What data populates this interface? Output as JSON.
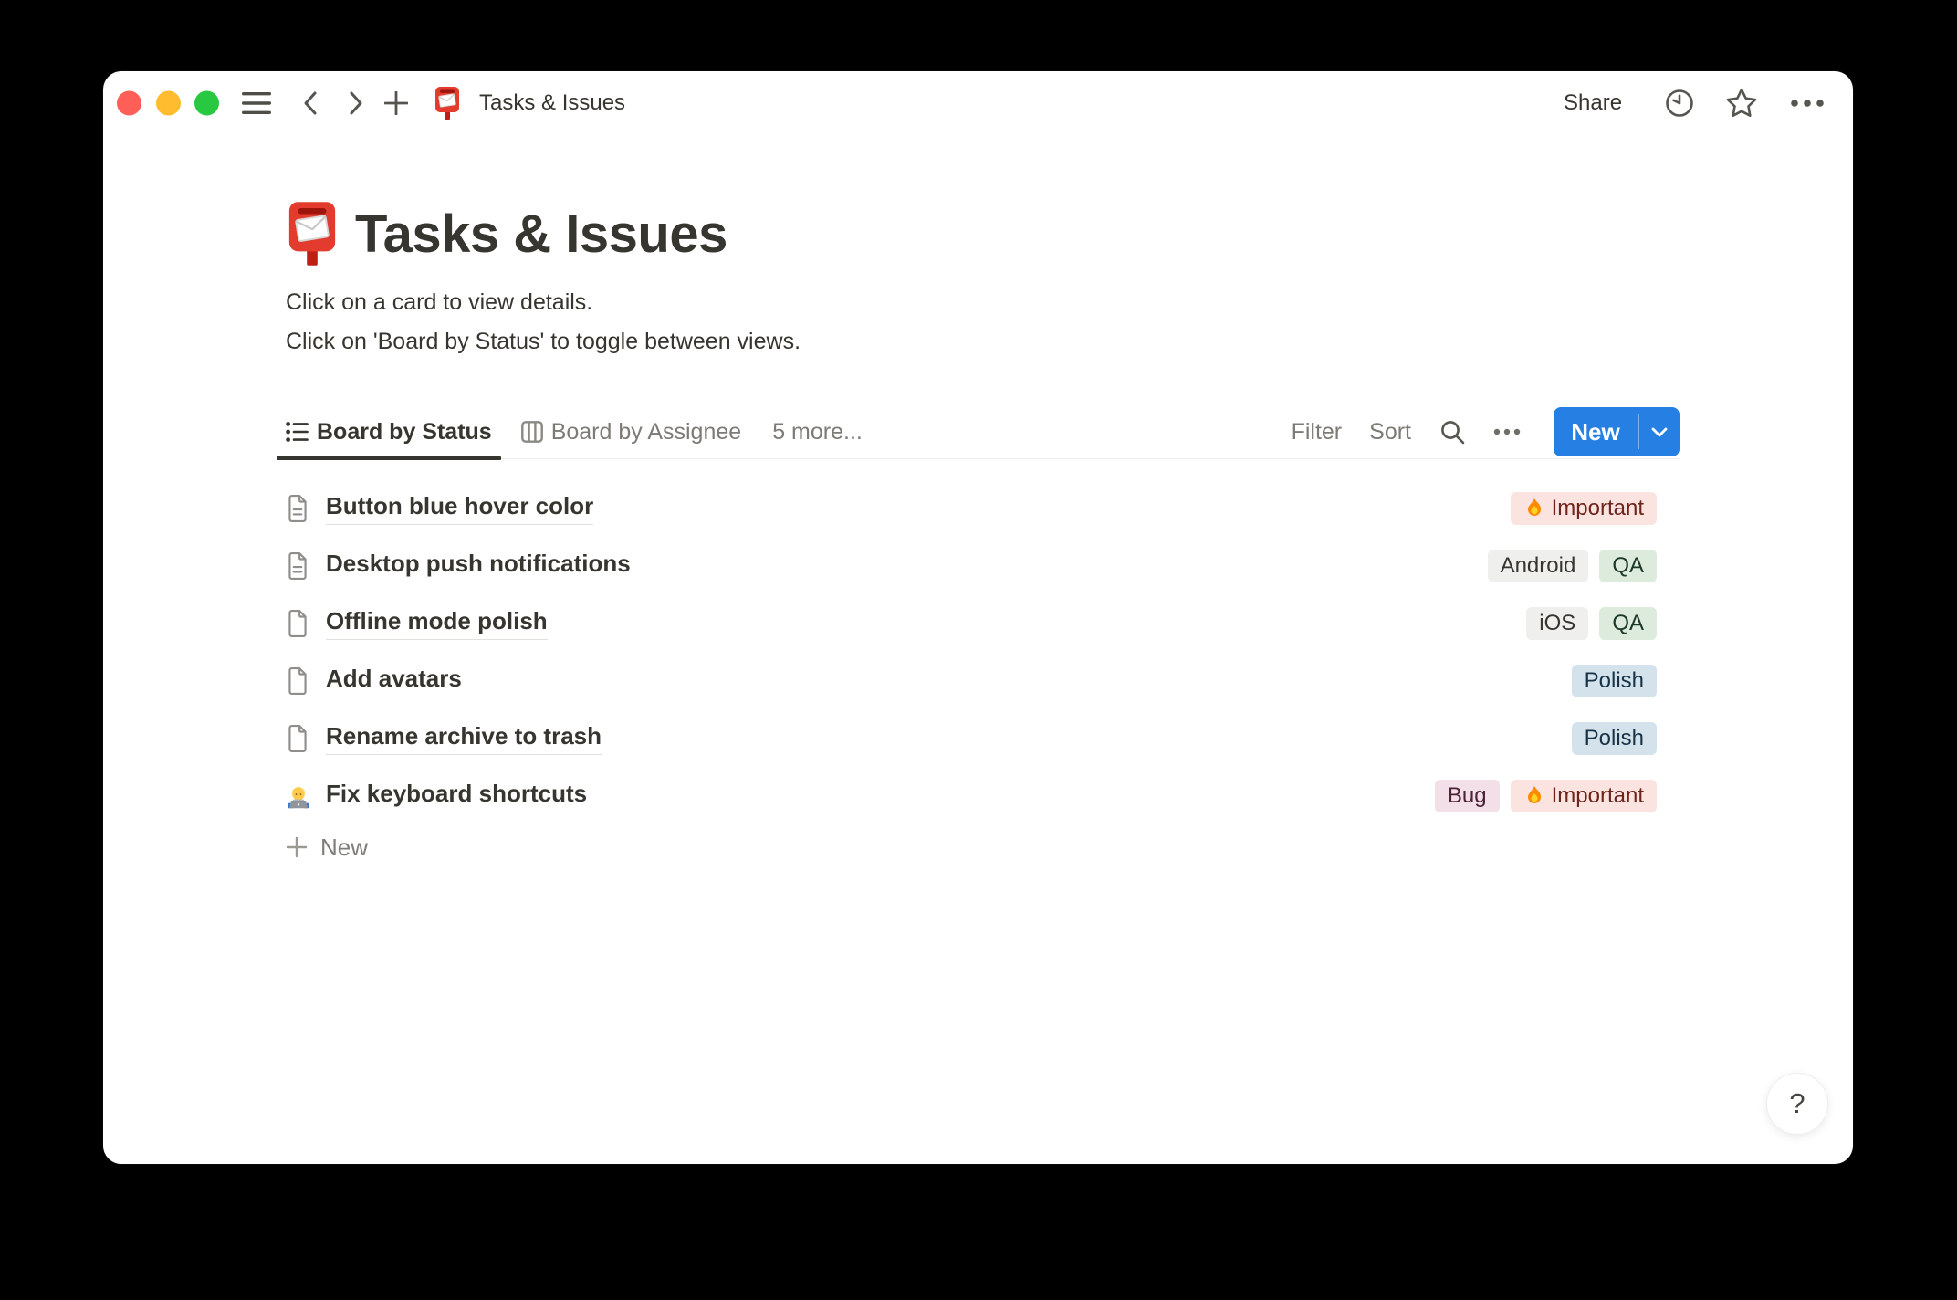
{
  "window": {
    "titlebar": {
      "title": "Tasks & Issues",
      "share_label": "Share",
      "icons": [
        "hamburger-icon",
        "back-chevron-icon",
        "forward-chevron-icon",
        "plus-icon",
        "postbox-icon",
        "clock-icon",
        "star-icon",
        "ellipsis-icon"
      ]
    }
  },
  "page": {
    "icon": "postbox-emoji",
    "title": "Tasks & Issues",
    "description_line1": "Click on a card to view details.",
    "description_line2": "Click on 'Board by Status' to toggle between views.",
    "tabs": {
      "board_by_status": "Board by Status",
      "board_by_assignee": "Board by Assignee",
      "more": "5 more..."
    },
    "toolbar": {
      "filter": "Filter",
      "sort": "Sort",
      "new": "New",
      "icons": [
        "search-icon",
        "ellipsis-icon",
        "chevron-down-icon"
      ]
    },
    "rows": [
      {
        "title": "Button blue hover color",
        "icon": "page-text-icon",
        "tags": [
          {
            "label": "Important",
            "color": "red",
            "icon": "fire-icon"
          }
        ]
      },
      {
        "title": "Desktop push notifications",
        "icon": "page-text-icon",
        "tags": [
          {
            "label": "Android",
            "color": "gray"
          },
          {
            "label": "QA",
            "color": "green"
          }
        ]
      },
      {
        "title": "Offline mode polish",
        "icon": "page-blank-icon",
        "tags": [
          {
            "label": "iOS",
            "color": "gray"
          },
          {
            "label": "QA",
            "color": "green"
          }
        ]
      },
      {
        "title": "Add avatars",
        "icon": "page-blank-icon",
        "tags": [
          {
            "label": "Polish",
            "color": "blue"
          }
        ]
      },
      {
        "title": "Rename archive to trash",
        "icon": "page-blank-icon",
        "tags": [
          {
            "label": "Polish",
            "color": "blue"
          }
        ]
      },
      {
        "title": "Fix keyboard shortcuts",
        "icon": "technologist-emoji",
        "tags": [
          {
            "label": "Bug",
            "color": "pink"
          },
          {
            "label": "Important",
            "color": "red",
            "icon": "fire-icon"
          }
        ]
      }
    ],
    "new_row_label": "New",
    "help_button_label": "?"
  },
  "colors": {
    "desktop_bg": "#000000",
    "window_bg": "#FFFFFF",
    "accent_blue": "#2680E3",
    "text_dark": "#37352F",
    "text_gray": "#7C7B76",
    "traffic_red": "#FF5F57",
    "traffic_yellow": "#FEBC2E",
    "traffic_green": "#28C840",
    "tag_red_bg": "#FBE4DF",
    "tag_red_text": "#6E241C",
    "tag_gray_bg": "#EFEFED",
    "tag_gray_text": "#37352F",
    "tag_green_bg": "#DCEBDC",
    "tag_green_text": "#1C3829",
    "tag_blue_bg": "#D4E2EB",
    "tag_blue_text": "#183347",
    "tag_pink_bg": "#F2DFE7",
    "tag_pink_text": "#4C2337",
    "active_tab_underline": "#37352F",
    "divider": "#ECECEA",
    "row_title_underline": "#E1E0DD"
  }
}
